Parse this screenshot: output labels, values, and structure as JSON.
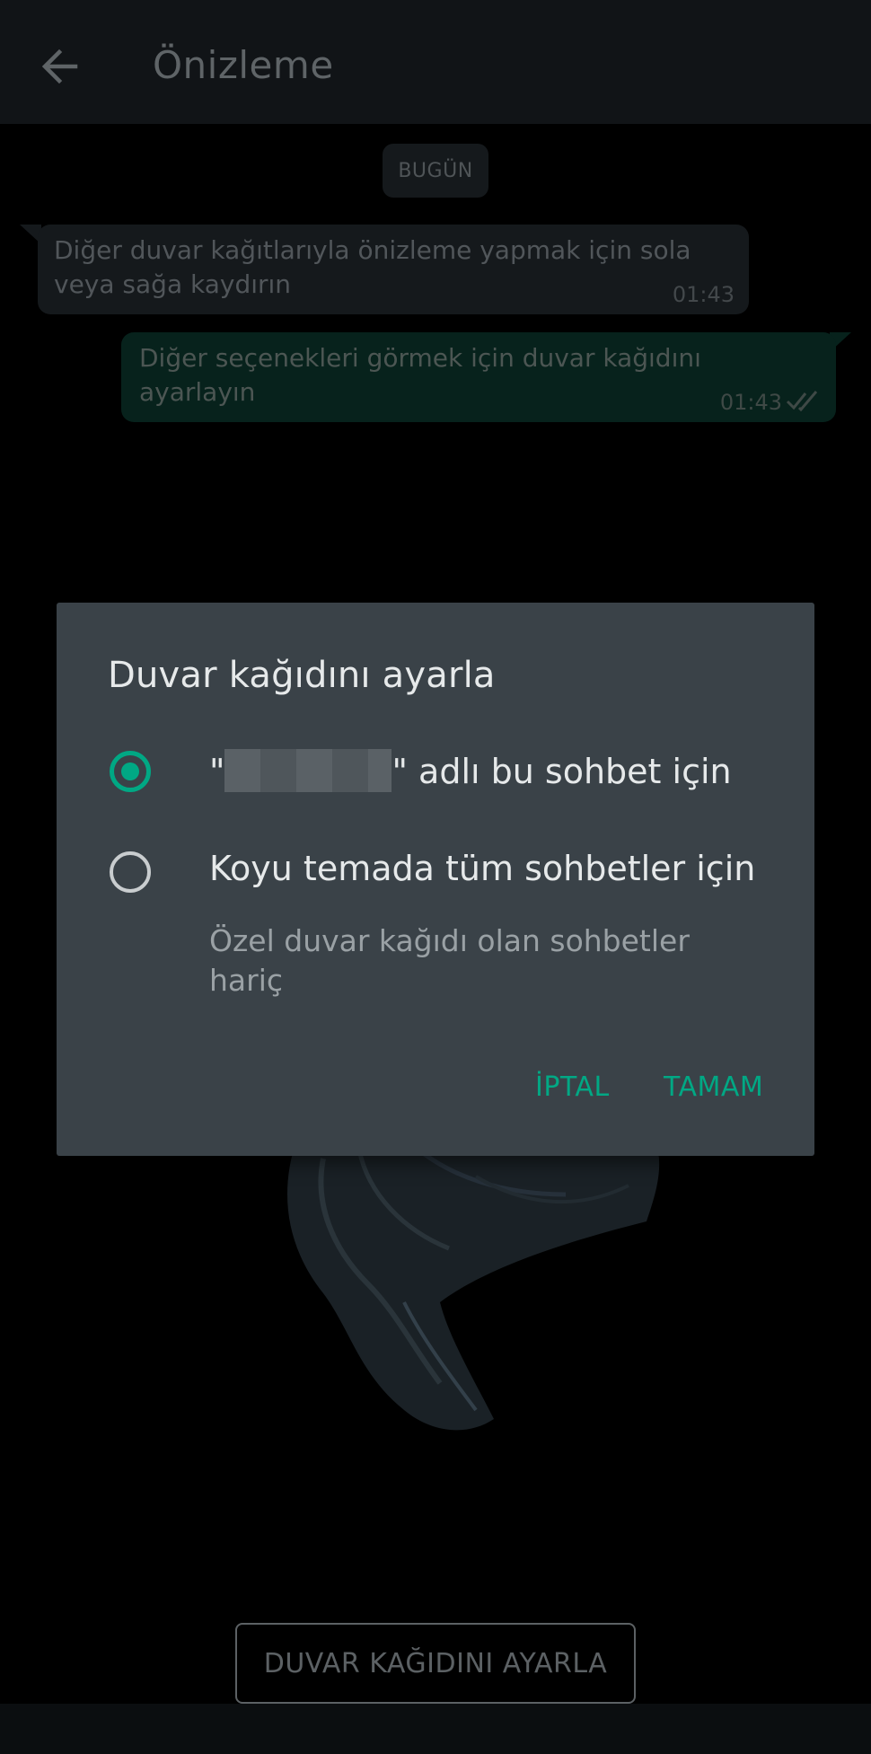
{
  "toolbar": {
    "title": "Önizleme",
    "back_icon": "arrow-left-icon"
  },
  "chat": {
    "date_chip": "BUGÜN",
    "messages": [
      {
        "direction": "incoming",
        "text": "Diğer duvar kağıtlarıyla önizleme yapmak için sola veya sağa kaydırın",
        "time": "01:43"
      },
      {
        "direction": "outgoing",
        "text": "Diğer seçenekleri görmek için duvar kağıdını ayarlayın",
        "time": "01:43",
        "status_icon": "double-check-icon"
      }
    ]
  },
  "dialog": {
    "title": "Duvar kağıdını ayarla",
    "options": [
      {
        "label_prefix": "\"",
        "label_suffix": "\" adlı bu sohbet için",
        "selected": true
      },
      {
        "label": "Koyu temada tüm sohbetler için",
        "sublabel": "Özel duvar kağıdı olan sohbetler hariç",
        "selected": false
      }
    ],
    "cancel_label": "İPTAL",
    "ok_label": "TAMAM",
    "accent_color": "#00a884"
  },
  "bottom": {
    "set_wallpaper_label": "DUVAR KAĞIDINI AYARLA"
  }
}
